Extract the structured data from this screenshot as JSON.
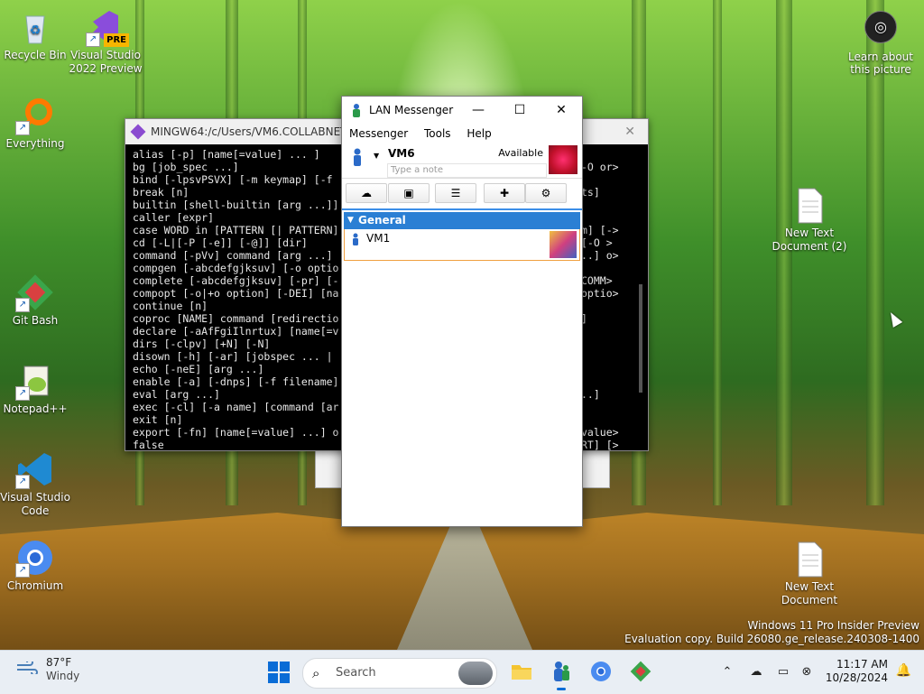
{
  "desktop": {
    "icons": [
      {
        "label": "Recycle Bin"
      },
      {
        "label": "Visual Studio 2022 Preview",
        "badge": "PRE"
      },
      {
        "label": "Everything"
      },
      {
        "label": "Git Bash"
      },
      {
        "label": "Notepad++"
      },
      {
        "label": "Visual Studio Code"
      },
      {
        "label": "Chromium"
      },
      {
        "label": "New Text Document (2)"
      },
      {
        "label": "New Text Document"
      }
    ],
    "learn_about": "Learn about this picture",
    "watermark_line1": "Windows 11 Pro Insider Preview",
    "watermark_line2": "Evaluation copy. Build 26080.ge_release.240308-1400"
  },
  "terminal": {
    "title": "MINGW64:/c/Users/VM6.COLLABNET",
    "close": "✕",
    "left_lines": [
      "alias [-p] [name[=value] ... ]",
      "bg [job_spec ...]",
      "bind [-lpsvPSVX] [-m keymap] [-f",
      "break [n]",
      "builtin [shell-builtin [arg ...]]",
      "caller [expr]",
      "case WORD in [PATTERN [| PATTERN]",
      "cd [-L|[-P [-e]] [-@]] [dir]",
      "command [-pVv] command [arg ...]",
      "compgen [-abcdefgjksuv] [-o optio",
      "complete [-abcdefgjksuv] [-pr] [-",
      "compopt [-o|+o option] [-DEI] [na",
      "continue [n]",
      "coproc [NAME] command [redirectio",
      "declare [-aAfFgiIlnrtux] [name[=v",
      "dirs [-clpv] [+N] [-N]",
      "disown [-h] [-ar] [jobspec ... |",
      "echo [-neE] [arg ...]",
      "enable [-a] [-dnps] [-f filename]",
      "eval [arg ...]",
      "exec [-cl] [-a name] [command [ar",
      "exit [n]",
      "export [-fn] [name[=value] ...] o",
      "false"
    ],
    "right_lines": [
      "",
      "-O or>",
      "",
      "ts]",
      "",
      "",
      "m] [->",
      "[-O >",
      "..] o>",
      "",
      "COMM>",
      "optio>",
      "",
      "]",
      "",
      "",
      "",
      "",
      "",
      "..]",
      "",
      "",
      "value>",
      "RT] [>"
    ]
  },
  "lan_messenger": {
    "title": "LAN Messenger",
    "minimize": "—",
    "maximize": "☐",
    "close": "✕",
    "menu": [
      "Messenger",
      "Tools",
      "Help"
    ],
    "user": {
      "name": "VM6",
      "status": "Available",
      "note_placeholder": "Type a note"
    },
    "group": "General",
    "contacts": [
      {
        "name": "VM1"
      }
    ]
  },
  "taskbar": {
    "weather_temp": "87°F",
    "weather_desc": "Windy",
    "search_placeholder": "Search",
    "time": "11:17 AM",
    "date": "10/28/2024"
  }
}
